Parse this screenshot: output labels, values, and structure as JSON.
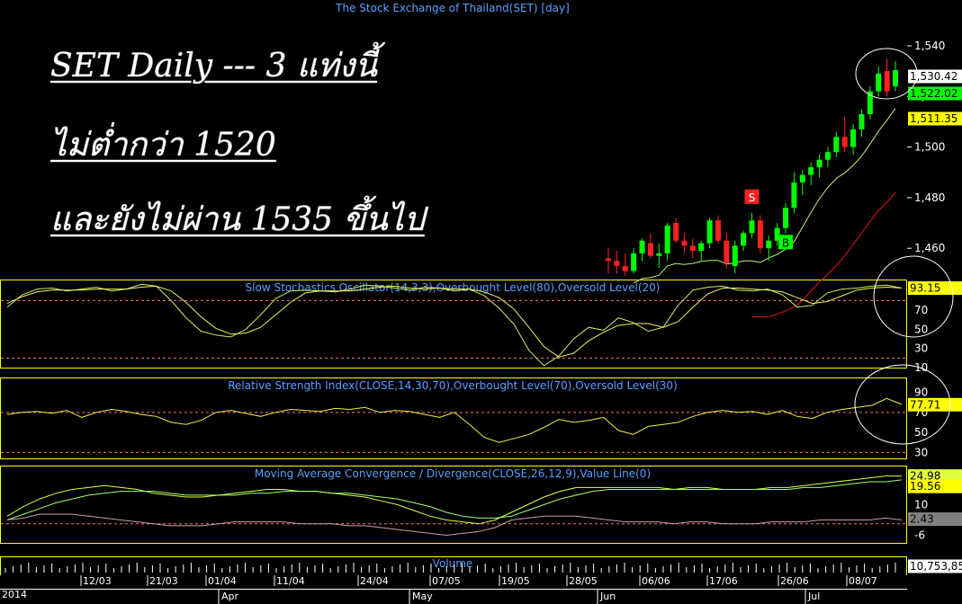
{
  "app": {
    "title": "The Stock Exchange of Thailand(SET) [day]"
  },
  "notes": {
    "line1": "SET Daily --- 3 แท่งนี้",
    "line2": "ไม่ต่ำกว่า 1520",
    "line3": "และยังไม่ผ่าน 1535 ขึ้นไป"
  },
  "colors": {
    "background": "#000000",
    "panel_border": "#ffff00",
    "up_candle": "#00ff00",
    "down_candle": "#ff2020",
    "ma_fast": "#b8f080",
    "ma_slow": "#e01818",
    "stoch_k": "#c8f060",
    "stoch_d": "#f0f060",
    "rsi": "#f0f040",
    "macd": "#e0ff40",
    "signal": "#a0ff70",
    "histogram": "#c9a0b0",
    "level_line": "#ff7070",
    "axis_text": "#ffffff",
    "title_text": "#5aa0ff"
  },
  "chart_data": [
    {
      "type": "candlestick",
      "title": "The Stock Exchange of Thailand(SET) [day]",
      "y_ticks": [
        1460,
        1480,
        1500,
        1520,
        1540
      ],
      "y_tick_labels": [
        "1,460",
        "1,480",
        "1,500",
        "1,520",
        "1,540"
      ],
      "ylim": [
        1448,
        1551
      ],
      "price_labels": [
        "1,530.42",
        "1,522.02",
        "1,511.35"
      ],
      "candles": [
        {
          "date": "2014-05-21",
          "open": 1456.0,
          "high": 1460.0,
          "low": 1450.0,
          "close": 1455.0
        },
        {
          "date": "2014-05-22",
          "open": 1455.0,
          "high": 1459.0,
          "low": 1450.0,
          "close": 1453.0
        },
        {
          "date": "2014-05-23",
          "open": 1453.0,
          "high": 1458.0,
          "low": 1449.0,
          "close": 1451.0
        },
        {
          "date": "2014-05-26",
          "open": 1451.0,
          "high": 1460.0,
          "low": 1450.0,
          "close": 1458.0
        },
        {
          "date": "2014-05-27",
          "open": 1458.0,
          "high": 1464.0,
          "low": 1455.0,
          "close": 1463.0
        },
        {
          "date": "2014-05-28",
          "open": 1462.0,
          "high": 1466.0,
          "low": 1456.0,
          "close": 1457.0
        },
        {
          "date": "2014-05-29",
          "open": 1457.0,
          "high": 1462.0,
          "low": 1452.0,
          "close": 1458.0
        },
        {
          "date": "2014-05-30",
          "open": 1458.0,
          "high": 1470.0,
          "low": 1455.0,
          "close": 1469.0
        },
        {
          "date": "2014-06-02",
          "open": 1470.0,
          "high": 1472.0,
          "low": 1462.0,
          "close": 1463.0
        },
        {
          "date": "2014-06-03",
          "open": 1463.0,
          "high": 1466.0,
          "low": 1458.0,
          "close": 1461.0
        },
        {
          "date": "2014-06-04",
          "open": 1461.0,
          "high": 1464.0,
          "low": 1456.0,
          "close": 1459.0
        },
        {
          "date": "2014-06-05",
          "open": 1459.0,
          "high": 1463.0,
          "low": 1455.0,
          "close": 1462.0
        },
        {
          "date": "2014-06-06",
          "open": 1462.0,
          "high": 1472.0,
          "low": 1460.0,
          "close": 1471.0
        },
        {
          "date": "2014-06-09",
          "open": 1471.0,
          "high": 1473.0,
          "low": 1462.0,
          "close": 1463.0
        },
        {
          "date": "2014-06-10",
          "open": 1463.0,
          "high": 1466.0,
          "low": 1452.0,
          "close": 1454.0
        },
        {
          "date": "2014-06-11",
          "open": 1453.0,
          "high": 1463.0,
          "low": 1450.0,
          "close": 1461.0
        },
        {
          "date": "2014-06-12",
          "open": 1461.0,
          "high": 1467.0,
          "low": 1459.0,
          "close": 1466.0
        },
        {
          "date": "2014-06-13",
          "open": 1466.0,
          "high": 1474.0,
          "low": 1464.0,
          "close": 1471.0
        },
        {
          "date": "2014-06-16",
          "open": 1471.0,
          "high": 1473.0,
          "low": 1458.0,
          "close": 1460.0
        },
        {
          "date": "2014-06-17",
          "open": 1460.0,
          "high": 1465.0,
          "low": 1455.0,
          "close": 1463.0
        },
        {
          "date": "2014-06-18",
          "open": 1463.0,
          "high": 1470.0,
          "low": 1461.0,
          "close": 1468.0
        },
        {
          "date": "2014-06-19",
          "open": 1468.0,
          "high": 1478.0,
          "low": 1466.0,
          "close": 1476.0
        },
        {
          "date": "2014-06-20",
          "open": 1476.0,
          "high": 1490.0,
          "low": 1474.0,
          "close": 1486.0
        },
        {
          "date": "2014-06-23",
          "open": 1486.0,
          "high": 1491.0,
          "low": 1481.0,
          "close": 1489.0
        },
        {
          "date": "2014-06-24",
          "open": 1489.0,
          "high": 1494.0,
          "low": 1485.0,
          "close": 1492.0
        },
        {
          "date": "2014-06-25",
          "open": 1492.0,
          "high": 1497.0,
          "low": 1488.0,
          "close": 1495.0
        },
        {
          "date": "2014-06-26",
          "open": 1495.0,
          "high": 1500.0,
          "low": 1492.0,
          "close": 1498.0
        },
        {
          "date": "2014-06-27",
          "open": 1498.0,
          "high": 1506.0,
          "low": 1496.0,
          "close": 1504.0
        },
        {
          "date": "2014-06-30",
          "open": 1504.0,
          "high": 1512.0,
          "low": 1498.0,
          "close": 1500.0
        },
        {
          "date": "2014-07-01",
          "open": 1500.0,
          "high": 1509.0,
          "low": 1497.0,
          "close": 1507.0
        },
        {
          "date": "2014-07-02",
          "open": 1507.0,
          "high": 1515.0,
          "low": 1504.0,
          "close": 1513.0
        },
        {
          "date": "2014-07-03",
          "open": 1513.0,
          "high": 1524.0,
          "low": 1511.0,
          "close": 1522.0
        },
        {
          "date": "2014-07-04",
          "open": 1522.0,
          "high": 1532.0,
          "low": 1520.0,
          "close": 1529.0
        },
        {
          "date": "2014-07-07",
          "open": 1530.0,
          "high": 1535.0,
          "low": 1520.0,
          "close": 1522.0
        },
        {
          "date": "2014-07-08",
          "open": 1524.0,
          "high": 1534.0,
          "low": 1522.0,
          "close": 1530.4
        }
      ],
      "signals": [
        {
          "label": "S",
          "date": "2014-06-13",
          "kind": "sell"
        },
        {
          "label": "B",
          "date": "2014-06-19",
          "kind": "buy"
        }
      ]
    },
    {
      "type": "line",
      "title": "Slow Stochastics Oscillator(14,3,3),Overbought Level(80),Oversold Level(20)",
      "y_ticks": [
        10,
        30,
        50,
        70,
        90
      ],
      "overbought": 80,
      "oversold": 20,
      "ylim": [
        10,
        101
      ],
      "last_value_label": "93.15",
      "series": [
        {
          "values": [
            73,
            86,
            92,
            93,
            90,
            92,
            94,
            90,
            92,
            97,
            95,
            80,
            62,
            48,
            44,
            42,
            50,
            65,
            82,
            90,
            91,
            90,
            89,
            92,
            96,
            95,
            93,
            91,
            94,
            93,
            90,
            92,
            85,
            72,
            55,
            28,
            12,
            22,
            40,
            52,
            49,
            62,
            57,
            48,
            52,
            75,
            91,
            94,
            95,
            91,
            90,
            92,
            86,
            73,
            75,
            88,
            92,
            93,
            95,
            96,
            93
          ]
        },
        {
          "values": [
            77,
            84,
            89,
            91,
            91,
            91,
            92,
            92,
            92,
            94,
            95,
            90,
            78,
            63,
            51,
            45,
            46,
            52,
            65,
            78,
            88,
            90,
            90,
            90,
            92,
            94,
            95,
            93,
            92,
            93,
            92,
            92,
            89,
            83,
            71,
            52,
            32,
            21,
            25,
            38,
            47,
            54,
            56,
            56,
            52,
            58,
            73,
            87,
            93,
            93,
            92,
            91,
            89,
            83,
            77,
            79,
            85,
            91,
            93,
            94,
            93
          ]
        }
      ]
    },
    {
      "type": "line",
      "title": "Relative Strength Index(CLOSE,14,30,70),Overbought Level(70),Oversold Level(30)",
      "y_ticks": [
        30,
        50,
        70,
        90
      ],
      "overbought": 70,
      "oversold": 30,
      "ylim": [
        24,
        104
      ],
      "last_value_label": "77.71",
      "series": [
        {
          "values": [
            68,
            70,
            71,
            69,
            72,
            65,
            70,
            73,
            71,
            68,
            66,
            60,
            58,
            62,
            70,
            72,
            69,
            66,
            70,
            73,
            72,
            71,
            74,
            73,
            75,
            70,
            72,
            71,
            68,
            65,
            70,
            58,
            45,
            40,
            44,
            48,
            55,
            63,
            60,
            62,
            65,
            52,
            48,
            56,
            58,
            60,
            66,
            70,
            72,
            70,
            71,
            68,
            72,
            66,
            64,
            70,
            73,
            75,
            77,
            84,
            78
          ]
        }
      ]
    },
    {
      "type": "line",
      "title": "Moving Average Convergence / Divergence(CLOSE,26,12,9),Value Line(0)",
      "y_ticks": [
        -6,
        2,
        10,
        18,
        26
      ],
      "ylim": [
        -10,
        30
      ],
      "value_line": 0,
      "value_labels": [
        "24.98",
        "19.56",
        "2.43"
      ],
      "series": [
        {
          "values": [
            4,
            9,
            13,
            16,
            18,
            19,
            20,
            19,
            18,
            16,
            15,
            14,
            14,
            15,
            16,
            17,
            18,
            18,
            17,
            17,
            16,
            15,
            14,
            12,
            10,
            7,
            4,
            2,
            1,
            0,
            2,
            6,
            10,
            14,
            17,
            19,
            19,
            19,
            19,
            19,
            19,
            18,
            19,
            19,
            18,
            18,
            18,
            19,
            19,
            20,
            21,
            22,
            23,
            24,
            25,
            25
          ]
        },
        {
          "values": [
            2,
            5,
            8,
            11,
            13,
            15,
            16,
            17,
            17,
            17,
            16,
            15,
            15,
            15,
            15,
            16,
            16,
            17,
            17,
            17,
            16,
            16,
            15,
            14,
            13,
            11,
            9,
            6,
            4,
            3,
            3,
            4,
            7,
            10,
            13,
            15,
            17,
            18,
            18,
            18,
            18,
            18,
            18,
            18,
            18,
            18,
            18,
            18,
            18,
            19,
            19,
            20,
            21,
            22,
            22,
            23
          ]
        },
        {
          "values": [
            2,
            3,
            5,
            5,
            5,
            4,
            3,
            2,
            1,
            0,
            -1,
            -1,
            -1,
            0,
            1,
            1,
            1,
            1,
            0,
            0,
            0,
            -1,
            -1,
            -2,
            -3,
            -4,
            -5,
            -6,
            -5,
            -4,
            -2,
            2,
            3,
            4,
            4,
            4,
            3,
            2,
            1,
            1,
            1,
            0,
            1,
            1,
            0,
            0,
            0,
            1,
            1,
            1,
            2,
            2,
            2,
            2,
            3,
            2
          ]
        }
      ]
    },
    {
      "type": "bar",
      "title": "Volume",
      "last_value_label": "10,753,85"
    }
  ],
  "x_axis": {
    "year_label": "2014",
    "date_ticks": [
      "12/03",
      "21/03",
      "01/04",
      "11/04",
      "24/04",
      "07/05",
      "19/05",
      "28/05",
      "06/06",
      "17/06",
      "26/06",
      "08/07"
    ],
    "month_ticks": [
      "Apr",
      "May",
      "Jun",
      "Jul"
    ]
  }
}
